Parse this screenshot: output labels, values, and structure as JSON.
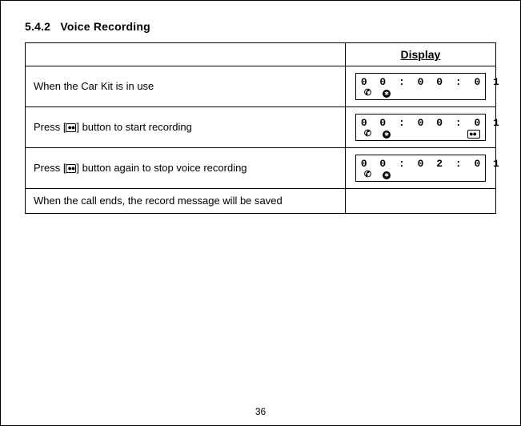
{
  "section": {
    "number": "5.4.2",
    "title": "Voice Recording"
  },
  "table": {
    "display_header": "Display",
    "rows": [
      {
        "instruction": "When the Car Kit is in use",
        "display": {
          "time": "0 0 : 0 0 : 0 1",
          "show_call": true,
          "show_bt": true,
          "show_tape": false
        }
      },
      {
        "instruction_prefix": "Press [",
        "instruction_suffix": "] button to start recording",
        "display": {
          "time": "0 0 : 0 0 : 0 1",
          "show_call": true,
          "show_bt": true,
          "show_tape": true
        }
      },
      {
        "instruction_prefix": "Press [",
        "instruction_suffix": "] button again to stop voice recording",
        "display": {
          "time": "0 0 : 0 2 : 0 1",
          "show_call": true,
          "show_bt": true,
          "show_tape": false
        }
      },
      {
        "instruction": "When the call ends,  the record message will be saved",
        "display": null
      }
    ]
  },
  "page_number": "36"
}
